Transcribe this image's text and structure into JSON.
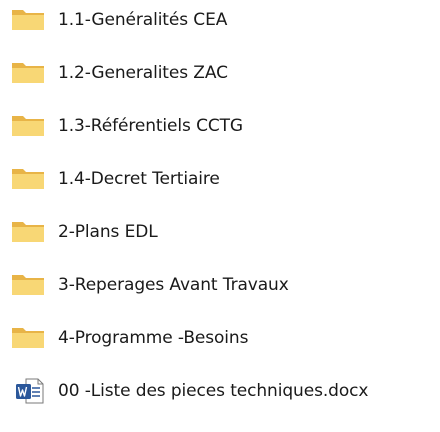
{
  "items": [
    {
      "label": "1.1-Genéralités CEA",
      "type": "folder",
      "icon": "folder-icon"
    },
    {
      "label": "1.2-Generalites ZAC",
      "type": "folder",
      "icon": "folder-icon"
    },
    {
      "label": "1.3-Référentiels CCTG",
      "type": "folder",
      "icon": "folder-icon"
    },
    {
      "label": "1.4-Decret Tertiaire",
      "type": "folder",
      "icon": "folder-icon"
    },
    {
      "label": "2-Plans EDL",
      "type": "folder",
      "icon": "folder-icon"
    },
    {
      "label": "3-Reperages Avant Travaux",
      "type": "folder",
      "icon": "folder-icon"
    },
    {
      "label": "4-Programme -Besoins",
      "type": "folder",
      "icon": "folder-icon"
    },
    {
      "label": "00 -Liste des pieces techniques.docx",
      "type": "document",
      "icon": "word-document-icon"
    }
  ],
  "colors": {
    "folder_back": "#e8b447",
    "folder_front": "#f8d775",
    "word_blue": "#2b579a"
  }
}
